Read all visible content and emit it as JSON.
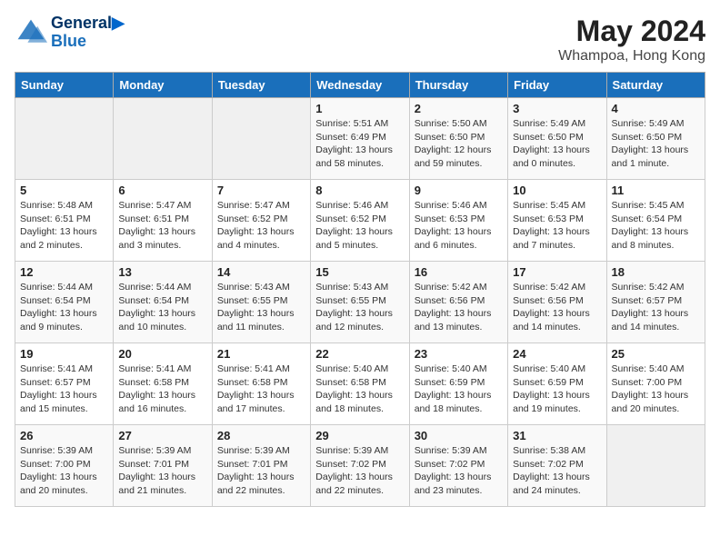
{
  "header": {
    "logo_line1": "General",
    "logo_line2": "Blue",
    "title": "May 2024",
    "subtitle": "Whampoa, Hong Kong"
  },
  "days_of_week": [
    "Sunday",
    "Monday",
    "Tuesday",
    "Wednesday",
    "Thursday",
    "Friday",
    "Saturday"
  ],
  "weeks": [
    [
      {
        "num": "",
        "detail": ""
      },
      {
        "num": "",
        "detail": ""
      },
      {
        "num": "",
        "detail": ""
      },
      {
        "num": "1",
        "detail": "Sunrise: 5:51 AM\nSunset: 6:49 PM\nDaylight: 13 hours\nand 58 minutes."
      },
      {
        "num": "2",
        "detail": "Sunrise: 5:50 AM\nSunset: 6:50 PM\nDaylight: 12 hours\nand 59 minutes."
      },
      {
        "num": "3",
        "detail": "Sunrise: 5:49 AM\nSunset: 6:50 PM\nDaylight: 13 hours\nand 0 minutes."
      },
      {
        "num": "4",
        "detail": "Sunrise: 5:49 AM\nSunset: 6:50 PM\nDaylight: 13 hours\nand 1 minute."
      }
    ],
    [
      {
        "num": "5",
        "detail": "Sunrise: 5:48 AM\nSunset: 6:51 PM\nDaylight: 13 hours\nand 2 minutes."
      },
      {
        "num": "6",
        "detail": "Sunrise: 5:47 AM\nSunset: 6:51 PM\nDaylight: 13 hours\nand 3 minutes."
      },
      {
        "num": "7",
        "detail": "Sunrise: 5:47 AM\nSunset: 6:52 PM\nDaylight: 13 hours\nand 4 minutes."
      },
      {
        "num": "8",
        "detail": "Sunrise: 5:46 AM\nSunset: 6:52 PM\nDaylight: 13 hours\nand 5 minutes."
      },
      {
        "num": "9",
        "detail": "Sunrise: 5:46 AM\nSunset: 6:53 PM\nDaylight: 13 hours\nand 6 minutes."
      },
      {
        "num": "10",
        "detail": "Sunrise: 5:45 AM\nSunset: 6:53 PM\nDaylight: 13 hours\nand 7 minutes."
      },
      {
        "num": "11",
        "detail": "Sunrise: 5:45 AM\nSunset: 6:54 PM\nDaylight: 13 hours\nand 8 minutes."
      }
    ],
    [
      {
        "num": "12",
        "detail": "Sunrise: 5:44 AM\nSunset: 6:54 PM\nDaylight: 13 hours\nand 9 minutes."
      },
      {
        "num": "13",
        "detail": "Sunrise: 5:44 AM\nSunset: 6:54 PM\nDaylight: 13 hours\nand 10 minutes."
      },
      {
        "num": "14",
        "detail": "Sunrise: 5:43 AM\nSunset: 6:55 PM\nDaylight: 13 hours\nand 11 minutes."
      },
      {
        "num": "15",
        "detail": "Sunrise: 5:43 AM\nSunset: 6:55 PM\nDaylight: 13 hours\nand 12 minutes."
      },
      {
        "num": "16",
        "detail": "Sunrise: 5:42 AM\nSunset: 6:56 PM\nDaylight: 13 hours\nand 13 minutes."
      },
      {
        "num": "17",
        "detail": "Sunrise: 5:42 AM\nSunset: 6:56 PM\nDaylight: 13 hours\nand 14 minutes."
      },
      {
        "num": "18",
        "detail": "Sunrise: 5:42 AM\nSunset: 6:57 PM\nDaylight: 13 hours\nand 14 minutes."
      }
    ],
    [
      {
        "num": "19",
        "detail": "Sunrise: 5:41 AM\nSunset: 6:57 PM\nDaylight: 13 hours\nand 15 minutes."
      },
      {
        "num": "20",
        "detail": "Sunrise: 5:41 AM\nSunset: 6:58 PM\nDaylight: 13 hours\nand 16 minutes."
      },
      {
        "num": "21",
        "detail": "Sunrise: 5:41 AM\nSunset: 6:58 PM\nDaylight: 13 hours\nand 17 minutes."
      },
      {
        "num": "22",
        "detail": "Sunrise: 5:40 AM\nSunset: 6:58 PM\nDaylight: 13 hours\nand 18 minutes."
      },
      {
        "num": "23",
        "detail": "Sunrise: 5:40 AM\nSunset: 6:59 PM\nDaylight: 13 hours\nand 18 minutes."
      },
      {
        "num": "24",
        "detail": "Sunrise: 5:40 AM\nSunset: 6:59 PM\nDaylight: 13 hours\nand 19 minutes."
      },
      {
        "num": "25",
        "detail": "Sunrise: 5:40 AM\nSunset: 7:00 PM\nDaylight: 13 hours\nand 20 minutes."
      }
    ],
    [
      {
        "num": "26",
        "detail": "Sunrise: 5:39 AM\nSunset: 7:00 PM\nDaylight: 13 hours\nand 20 minutes."
      },
      {
        "num": "27",
        "detail": "Sunrise: 5:39 AM\nSunset: 7:01 PM\nDaylight: 13 hours\nand 21 minutes."
      },
      {
        "num": "28",
        "detail": "Sunrise: 5:39 AM\nSunset: 7:01 PM\nDaylight: 13 hours\nand 22 minutes."
      },
      {
        "num": "29",
        "detail": "Sunrise: 5:39 AM\nSunset: 7:02 PM\nDaylight: 13 hours\nand 22 minutes."
      },
      {
        "num": "30",
        "detail": "Sunrise: 5:39 AM\nSunset: 7:02 PM\nDaylight: 13 hours\nand 23 minutes."
      },
      {
        "num": "31",
        "detail": "Sunrise: 5:38 AM\nSunset: 7:02 PM\nDaylight: 13 hours\nand 24 minutes."
      },
      {
        "num": "",
        "detail": ""
      }
    ]
  ]
}
